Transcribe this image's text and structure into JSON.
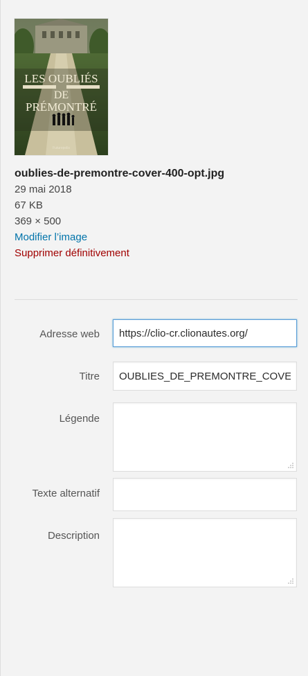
{
  "attachment": {
    "thumbnail": {
      "title_line1": "LES OUBLIÉS",
      "title_line2": "DE",
      "title_line3": "PRÉMONTRÉ",
      "publisher": "Futuropolis"
    },
    "filename": "oublies-de-premontre-cover-400-opt.jpg",
    "date": "29 mai 2018",
    "filesize": "67 KB",
    "dimensions": "369 × 500",
    "edit_link": "Modifier l’image",
    "delete_link": "Supprimer définitivement"
  },
  "fields": {
    "url": {
      "label": "Adresse web",
      "value": "https://clio-cr.clionautes.org/"
    },
    "title": {
      "label": "Titre",
      "value": "OUBLIES_DE_PREMONTRE_COVER"
    },
    "caption": {
      "label": "Légende",
      "value": ""
    },
    "alt": {
      "label": "Texte alternatif",
      "value": ""
    },
    "description": {
      "label": "Description",
      "value": ""
    }
  },
  "colors": {
    "link": "#0073aa",
    "delete": "#a00000",
    "focus_border": "#5b9dd9",
    "panel_bg": "#f3f3f3"
  }
}
